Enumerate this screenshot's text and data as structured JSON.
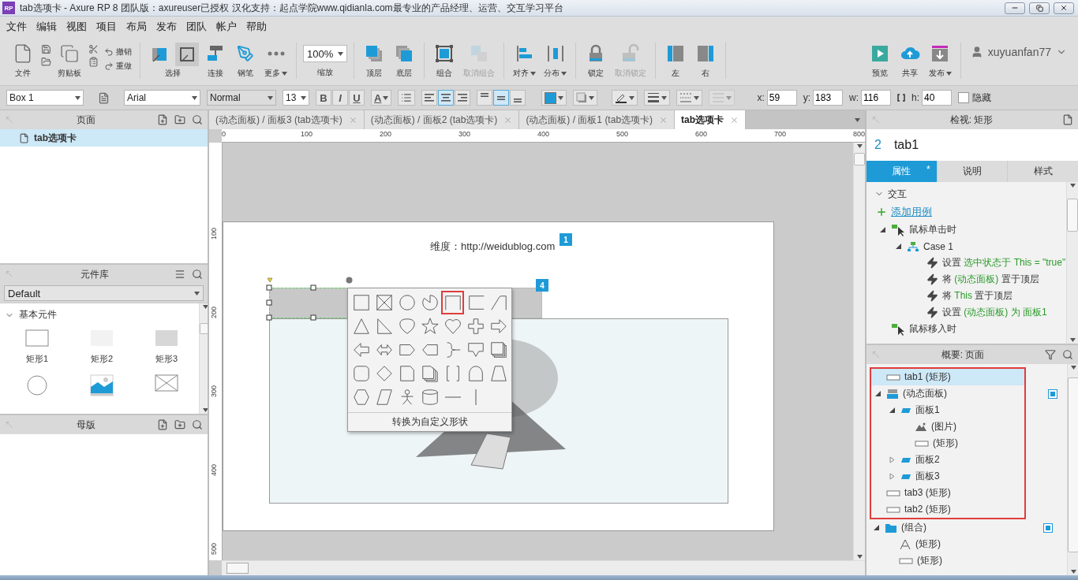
{
  "window": {
    "logo": "RP",
    "title": "tab选项卡 - Axure RP 8 团队版：axureuser已授权 汉化支持：起点学院www.qidianla.com最专业的产品经理、运营、交互学习平台"
  },
  "menu": [
    "文件",
    "编辑",
    "视图",
    "项目",
    "布局",
    "发布",
    "团队",
    "帐户",
    "帮助"
  ],
  "toolbar": {
    "groups": [
      {
        "items": [
          {
            "kind": "file",
            "label": "文件",
            "disabled": false
          },
          {
            "kind": "clipboard",
            "label": "剪贴板",
            "disabled": false
          },
          {
            "kind": "history",
            "rows": [
              {
                "label": "撤销",
                "disabled": false
              },
              {
                "label": "重做",
                "disabled": false
              }
            ]
          }
        ]
      },
      {
        "items": [
          {
            "kind": "select",
            "label": "选择",
            "modes": [
              {
                "selected": false
              },
              {
                "selected": true
              }
            ]
          },
          {
            "kind": "tool",
            "label": "连接",
            "disabled": false
          },
          {
            "kind": "tool",
            "label": "钢笔",
            "disabled": false
          },
          {
            "kind": "tool",
            "label": "更多",
            "caret": true,
            "disabled": false
          }
        ]
      },
      {
        "items": [
          {
            "kind": "zoom",
            "value": "100%",
            "label": "缩放"
          }
        ]
      },
      {
        "items": [
          {
            "kind": "tool",
            "label": "顶层",
            "disabled": false
          },
          {
            "kind": "tool",
            "label": "底层",
            "disabled": false
          }
        ]
      },
      {
        "items": [
          {
            "kind": "tool",
            "label": "组合",
            "disabled": false
          },
          {
            "kind": "tool",
            "label": "取消组合",
            "disabled": true
          }
        ]
      },
      {
        "items": [
          {
            "kind": "tool",
            "label": "对齐",
            "caret": true,
            "disabled": false
          },
          {
            "kind": "tool",
            "label": "分布",
            "caret": true,
            "disabled": false
          }
        ]
      },
      {
        "items": [
          {
            "kind": "tool",
            "label": "锁定",
            "disabled": false
          },
          {
            "kind": "tool",
            "label": "取消锁定",
            "disabled": true
          }
        ]
      },
      {
        "items": [
          {
            "kind": "tool",
            "label": "左",
            "disabled": false
          },
          {
            "kind": "tool",
            "label": "右",
            "disabled": false
          }
        ]
      }
    ],
    "actions": [
      {
        "label": "预览",
        "disabled": false
      },
      {
        "label": "共享",
        "disabled": false
      },
      {
        "label": "发布",
        "caret": true,
        "disabled": false
      }
    ],
    "user": "xuyuanfan77"
  },
  "format_bar": {
    "widget_name": "Box 1",
    "font": "Arial",
    "font_style": "Normal",
    "font_size": "13",
    "text_styles": [
      {
        "label": "B",
        "selected": false
      },
      {
        "label": "I",
        "selected": false
      },
      {
        "label": "U",
        "selected": false
      }
    ],
    "font_color_label": "A",
    "h_align": [
      {
        "selected": false
      },
      {
        "selected": true
      },
      {
        "selected": false
      }
    ],
    "v_align": [
      {
        "selected": false
      },
      {
        "selected": true
      },
      {
        "selected": false
      }
    ],
    "line_tools": [
      {
        "disabled": false
      },
      {
        "disabled": false
      },
      {
        "disabled": false
      },
      {
        "disabled": true
      }
    ],
    "geometry": [
      {
        "label": "x:",
        "value": "59"
      },
      {
        "label": "y:",
        "value": "183"
      },
      {
        "label": "w:",
        "value": "116"
      },
      {
        "label": "h:",
        "value": "40"
      }
    ],
    "hidden": {
      "label": "隐藏",
      "checked": false
    }
  },
  "pages_panel": {
    "title": "页面",
    "items": [
      {
        "label": "tab选项卡",
        "selected": true
      }
    ]
  },
  "library_panel": {
    "title": "元件库",
    "library": "Default",
    "section": {
      "label": "基本元件",
      "expanded": true
    },
    "widgets": [
      {
        "kind": "outline",
        "label": "矩形1"
      },
      {
        "kind": "light",
        "label": "矩形2"
      },
      {
        "kind": "gray",
        "label": "矩形3"
      },
      {
        "kind": "circle"
      },
      {
        "kind": "image"
      },
      {
        "kind": "placeholder"
      }
    ]
  },
  "masters_panel": {
    "title": "母版"
  },
  "editor": {
    "tabs": [
      {
        "label": "(动态面板) / 面板3 (tab选项卡)",
        "selected": false
      },
      {
        "label": "(动态面板) / 面板2 (tab选项卡)",
        "selected": false
      },
      {
        "label": "(动态面板) / 面板1 (tab选项卡)",
        "selected": false
      },
      {
        "label": "tab选项卡",
        "selected": true
      }
    ],
    "rulers": {
      "horizontal": [
        "0",
        "100",
        "200",
        "300",
        "400",
        "500",
        "600",
        "700",
        "800"
      ],
      "vertical": [
        "100",
        "200",
        "300",
        "400",
        "500"
      ]
    },
    "canvas": {
      "caption": "维度：http://weidublog.com",
      "badges": [
        "1",
        "4"
      ],
      "shape_menu": {
        "shapes": [
          {
            "selected": false
          },
          {
            "selected": false
          },
          {
            "selected": false
          },
          {
            "selected": false
          },
          {
            "selected": true
          },
          {
            "selected": false
          },
          {
            "selected": false
          },
          {
            "selected": false
          },
          {
            "selected": false
          },
          {
            "selected": false
          },
          {
            "selected": false
          },
          {
            "selected": false
          },
          {
            "selected": false
          },
          {
            "selected": false
          },
          {
            "selected": false
          },
          {
            "selected": false
          },
          {
            "selected": false
          },
          {
            "selected": false
          },
          {
            "selected": false
          },
          {
            "selected": false
          },
          {
            "selected": false
          },
          {
            "selected": false
          },
          {
            "selected": false
          },
          {
            "selected": false
          },
          {
            "selected": false
          },
          {
            "selected": false
          },
          {
            "selected": false
          },
          {
            "selected": false
          },
          {
            "selected": false
          },
          {
            "selected": false
          },
          {
            "selected": false
          },
          {
            "selected": false
          },
          {
            "selected": false
          },
          {
            "selected": false
          }
        ],
        "footer": "转换为自定义形状"
      }
    }
  },
  "inspector": {
    "title": "检视: 矩形",
    "number": "2",
    "name": "tab1",
    "tabs": [
      {
        "label": "属性",
        "badge": "*",
        "selected": true
      },
      {
        "label": "说明",
        "selected": false
      },
      {
        "label": "样式",
        "selected": false
      }
    ],
    "interactions": {
      "title": "交互",
      "expanded": true,
      "add_link": "添加用例",
      "events": [
        {
          "label": "鼠标单击时",
          "expanded": true,
          "cases": [
            {
              "label": "Case 1",
              "expanded": true,
              "actions": [
                [
                  {
                    "kind": "plain",
                    "text": "设置 "
                  },
                  {
                    "kind": "value",
                    "text": "选中状态于 This = \"true\""
                  }
                ],
                [
                  {
                    "kind": "plain",
                    "text": "将 "
                  },
                  {
                    "kind": "value",
                    "text": "(动态面板)"
                  },
                  {
                    "kind": "plain",
                    "text": " 置于顶层"
                  }
                ],
                [
                  {
                    "kind": "plain",
                    "text": "将 "
                  },
                  {
                    "kind": "value",
                    "text": "This"
                  },
                  {
                    "kind": "plain",
                    "text": " 置于顶层"
                  }
                ],
                [
                  {
                    "kind": "plain",
                    "text": "设置 "
                  },
                  {
                    "kind": "value",
                    "text": "(动态面板) 为 面板1"
                  }
                ]
              ]
            }
          ]
        },
        {
          "label": "鼠标移入时"
        }
      ]
    }
  },
  "outline": {
    "title": "概要: 页面",
    "highlighted": [
      {
        "kind": "rect",
        "label": "tab1 (矩形)",
        "selected": true
      },
      {
        "kind": "dynamic-panel",
        "label": "(动态面板)",
        "selected": false,
        "expanded": true,
        "marker": true,
        "children": [
          {
            "kind": "state",
            "label": "面板1",
            "selected": false,
            "expanded": true,
            "children": [
              {
                "kind": "image",
                "label": "(图片)",
                "selected": false
              },
              {
                "kind": "rect",
                "label": "(矩形)",
                "selected": false
              }
            ]
          },
          {
            "kind": "state",
            "label": "面板2",
            "selected": false,
            "expanded": false
          },
          {
            "kind": "state",
            "label": "面板3",
            "selected": false,
            "expanded": false
          }
        ]
      },
      {
        "kind": "rect",
        "label": "tab3 (矩形)",
        "selected": false
      },
      {
        "kind": "rect",
        "label": "tab2 (矩形)",
        "selected": false
      }
    ],
    "items": [
      {
        "kind": "group",
        "label": "(组合)",
        "selected": false,
        "expanded": true,
        "marker": true,
        "children": [
          {
            "kind": "text",
            "label": "(矩形)",
            "selected": false
          },
          {
            "kind": "rect",
            "label": "(矩形)",
            "selected": false
          }
        ]
      }
    ]
  }
}
